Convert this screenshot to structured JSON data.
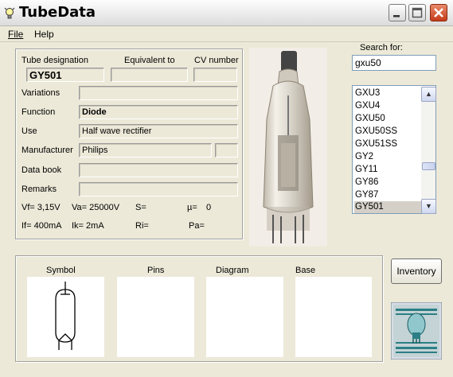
{
  "window": {
    "title": "TubeData"
  },
  "menu": {
    "file": "File",
    "help": "Help"
  },
  "header": {
    "designation_label": "Tube designation",
    "equivalent_label": "Equivalent to",
    "cv_label": "CV number",
    "designation": "GY501",
    "equivalent": "",
    "cv": ""
  },
  "fields": {
    "variations": {
      "label": "Variations",
      "value": ""
    },
    "function": {
      "label": "Function",
      "value": "Diode"
    },
    "use": {
      "label": "Use",
      "value": "Half wave rectifier"
    },
    "manufacturer": {
      "label": "Manufacturer",
      "value": "Philips",
      "extra": ""
    },
    "databook": {
      "label": "Data book",
      "value": ""
    },
    "remarks": {
      "label": "Remarks",
      "value": ""
    }
  },
  "params": {
    "vf": "Vf= 3,15V",
    "va": "Va= 25000V",
    "s": "S=",
    "mu_label": "µ=",
    "mu_value": "0",
    "if": "If= 400mA",
    "ik": "Ik=  2mA",
    "ri": "Ri=",
    "pa": "Pa="
  },
  "search": {
    "label": "Search for:",
    "value": "gxu50"
  },
  "list": {
    "items": [
      "GXU3",
      "GXU4",
      "GXU50",
      "GXU50SS",
      "GXU51SS",
      "GY2",
      "GY11",
      "GY86",
      "GY87",
      "GY501"
    ],
    "selected_index": 9
  },
  "bottom": {
    "symbol": "Symbol",
    "pins": "Pins",
    "diagram": "Diagram",
    "base": "Base"
  },
  "buttons": {
    "inventory": "Inventory"
  },
  "colors": {
    "close_button": "#c63b1a",
    "selected_item": "#d4d0c8",
    "listbox_border": "#7f9db9"
  },
  "icons": {
    "app": "lightbulb-icon",
    "minimize": "minimize-icon",
    "maximize": "maximize-icon",
    "close": "close-icon"
  }
}
